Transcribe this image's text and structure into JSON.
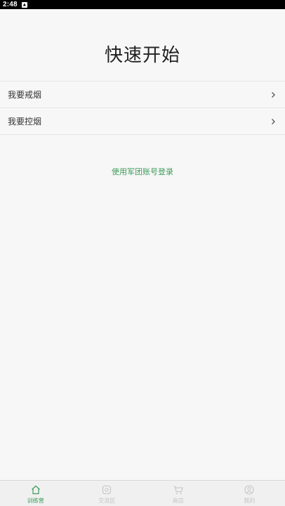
{
  "status_bar": {
    "time": "2:48"
  },
  "page": {
    "title": "快速开始"
  },
  "options": [
    {
      "label": "我要戒烟"
    },
    {
      "label": "我要控烟"
    }
  ],
  "login": {
    "label": "使用军团账号登录"
  },
  "tabs": [
    {
      "label": "训练营",
      "icon": "home-icon",
      "active": true
    },
    {
      "label": "交流区",
      "icon": "chat-icon",
      "active": false
    },
    {
      "label": "商店",
      "icon": "cart-icon",
      "active": false
    },
    {
      "label": "我的",
      "icon": "user-icon",
      "active": false
    }
  ],
  "colors": {
    "accent": "#3d9b5a",
    "inactive_tab": "#c4c4c4",
    "background": "#f7f7f7"
  }
}
